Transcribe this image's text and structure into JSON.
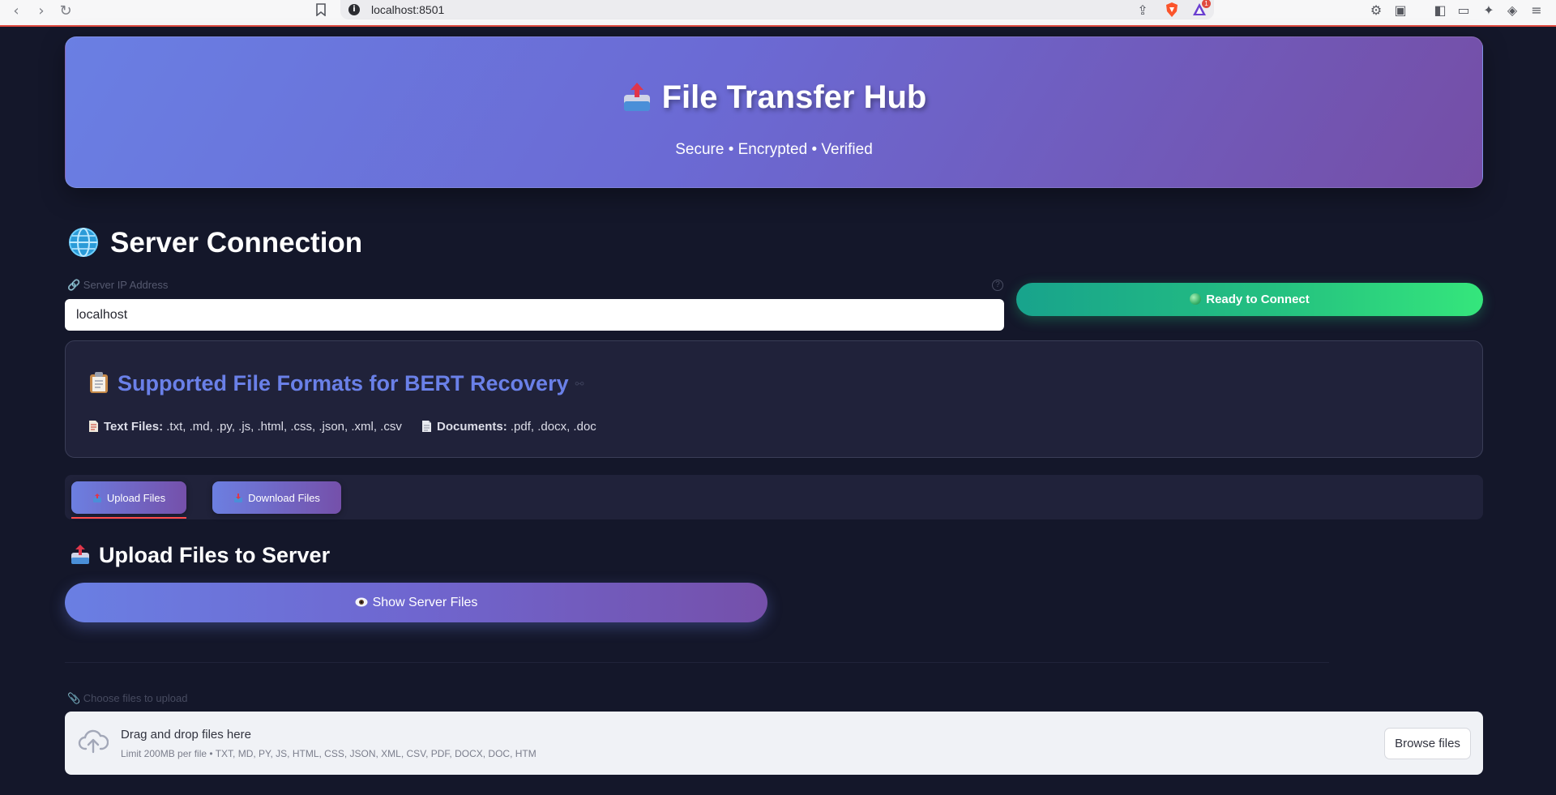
{
  "browser": {
    "url": "localhost:8501",
    "rewards_badge": "1"
  },
  "hero": {
    "title": "File Transfer Hub",
    "subtitle": "Secure • Encrypted • Verified"
  },
  "connection": {
    "section_title": "Server Connection",
    "ip_label": "🔗 Server IP Address",
    "ip_value": "localhost",
    "help_symbol": "?",
    "status_button": "Ready to Connect"
  },
  "formats": {
    "title": "Supported File Formats for BERT Recovery",
    "text_label": "Text Files:",
    "text_exts": " .txt, .md, .py, .js, .html, .css, .json, .xml, .csv",
    "doc_label": "Documents:",
    "doc_exts": " .pdf, .docx, .doc"
  },
  "tabs": [
    {
      "label": "Upload Files",
      "active": true
    },
    {
      "label": "Download Files",
      "active": false
    }
  ],
  "upload": {
    "title": "Upload Files to Server",
    "show_button": "Show Server Files",
    "choose_label": "📎 Choose files to upload",
    "drop_title": "Drag and drop files here",
    "drop_limit": "Limit 200MB per file • TXT, MD, PY, JS, HTML, CSS, JSON, XML, CSV, PDF, DOCX, DOC, HTM",
    "browse_button": "Browse files"
  },
  "colors": {
    "accent": "#6a80e8",
    "hero_start": "#6a7fe3",
    "hero_end": "#754ea6",
    "connect_start": "#18a38c",
    "connect_end": "#35e67c",
    "tab_underline": "#ff4b4b"
  }
}
